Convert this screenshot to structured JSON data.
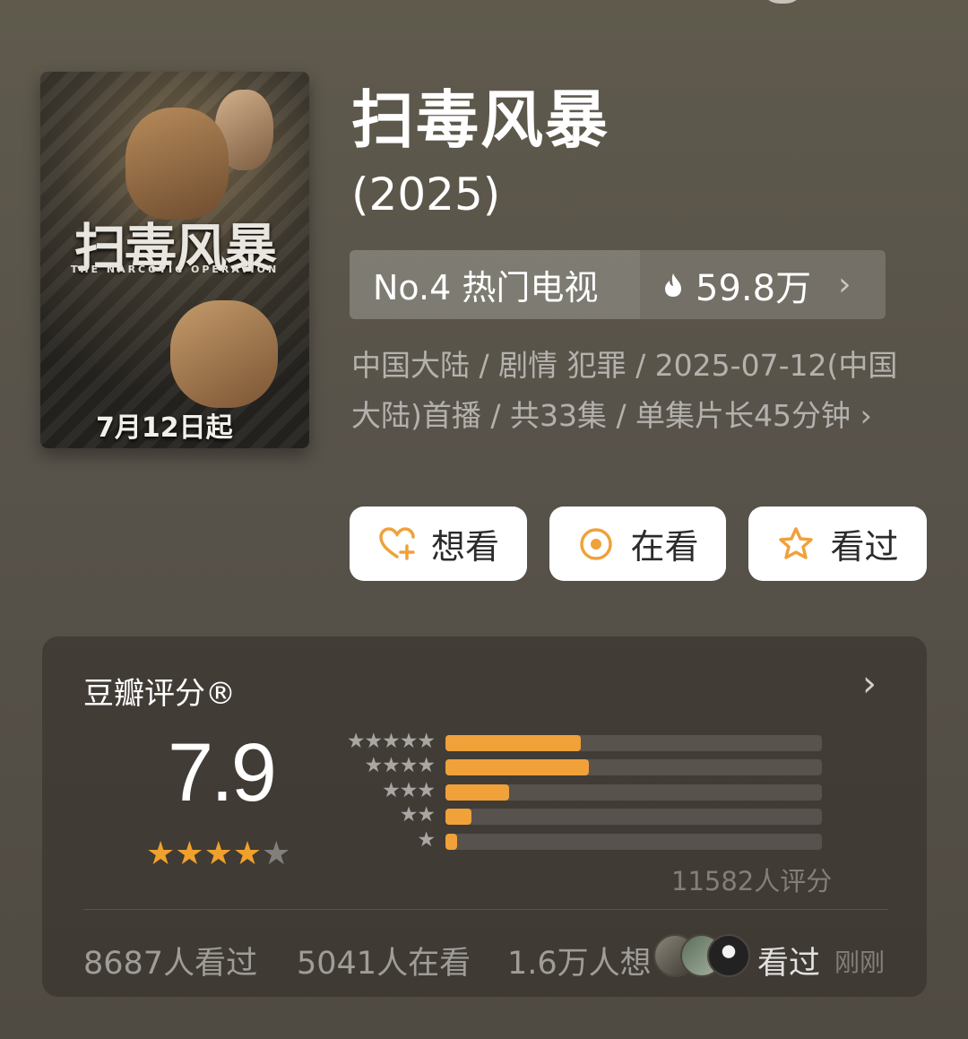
{
  "poster": {
    "title_text": "扫毒风暴",
    "subtitle_text": "THE NARCOTIC OPERATION",
    "date_text": "7月12日起"
  },
  "title": "扫毒风暴",
  "year": "(2025)",
  "rank": {
    "label": "No.4 热门电视",
    "heat": "59.8万"
  },
  "meta_text": "中国大陆 / 剧情 犯罪 / 2025-07-12(中国大陆)首播 / 共33集 / 单集片长45分钟",
  "actions": {
    "want": "想看",
    "watching": "在看",
    "watched": "看过"
  },
  "rating": {
    "title": "豆瓣评分®",
    "score": "7.9",
    "stars_filled": 4,
    "distribution": [
      {
        "stars": "★★★★★",
        "fraction": 0.36
      },
      {
        "stars": "★★★★",
        "fraction": 0.38
      },
      {
        "stars": "★★★",
        "fraction": 0.17
      },
      {
        "stars": "★★",
        "fraction": 0.07
      },
      {
        "stars": "★",
        "fraction": 0.03
      }
    ],
    "count_text": "11582人评分"
  },
  "stats": {
    "watched": "8687人看过",
    "watching": "5041人在看",
    "wanted": "1.6万人想"
  },
  "activity": {
    "label": "看过",
    "time": "刚刚"
  },
  "colors": {
    "accent": "#f0a13a",
    "star_on": "#f0a02c"
  }
}
